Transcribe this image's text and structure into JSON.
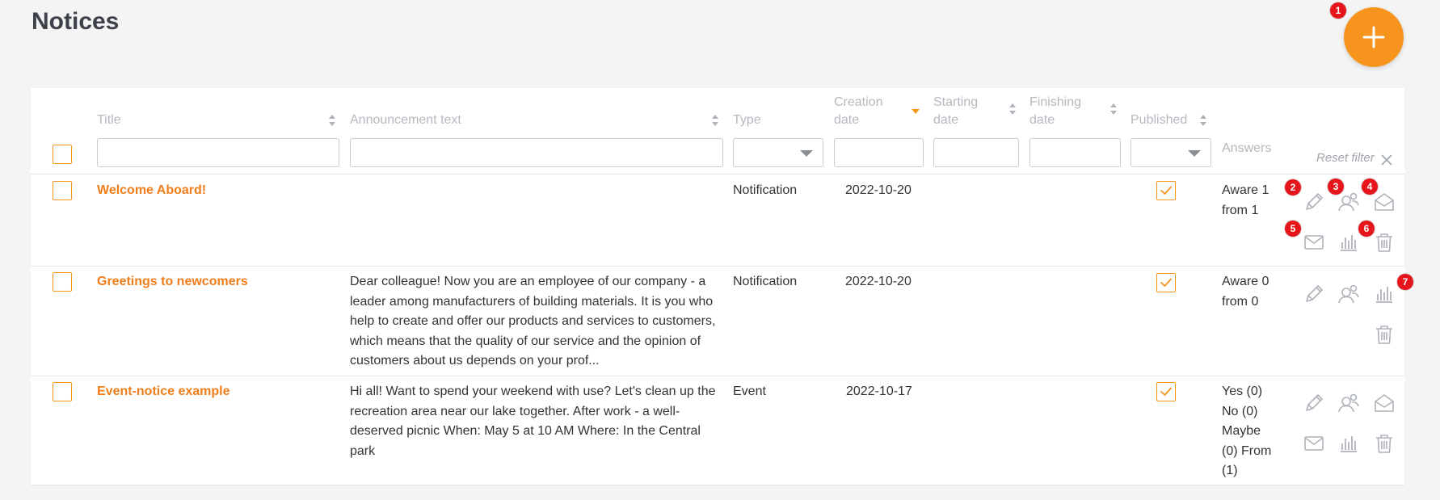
{
  "page": {
    "title": "Notices"
  },
  "toolbar": {
    "add_label": "+"
  },
  "table": {
    "headers": {
      "title": "Title",
      "announcement": "Announcement text",
      "type": "Type",
      "creation_date": "Creation date",
      "starting_date": "Starting date",
      "finishing_date": "Finishing date",
      "published": "Published",
      "answers": "Answers"
    },
    "reset_filter": "Reset filter",
    "rows": [
      {
        "title": "Welcome Aboard!",
        "announcement": "",
        "type": "Notification",
        "creation_date": "2022-10-20",
        "starting_date": "",
        "finishing_date": "",
        "published": true,
        "answers": "Aware 1 from 1"
      },
      {
        "title": "Greetings to newcomers",
        "announcement": "Dear colleague! Now you are an employee of our company - a leader among manufacturers of building materials. It is you who help to create and offer our products and services to customers, which means that the quality of our service and the opinion of customers about us depends on your prof...",
        "type": "Notification",
        "creation_date": "2022-10-20",
        "starting_date": "",
        "finishing_date": "",
        "published": true,
        "answers": "Aware 0 from 0"
      },
      {
        "title": "Event-notice example",
        "announcement": "Hi all!  Want to spend your weekend with use? Let's clean up the recreation area near our lake together. After work - a well-deserved picnic  When: May 5 at 10 AM  Where: In the Central park",
        "type": "Event",
        "creation_date": "2022-10-17",
        "starting_date": "",
        "finishing_date": "",
        "published": true,
        "answers": "Yes (0) No (0) Maybe (0) From (1)"
      }
    ]
  },
  "markers": [
    "1",
    "2",
    "3",
    "4",
    "5",
    "6",
    "7"
  ],
  "icons": {
    "add": "plus-icon",
    "edit": "pencil-icon",
    "recipients": "users-icon",
    "open_mail": "envelope-open-icon",
    "mail": "envelope-icon",
    "stats": "bar-chart-icon",
    "delete": "trash-icon"
  },
  "colors": {
    "accent": "#f7941d",
    "link": "#f07d1a",
    "marker": "#e8141c",
    "icon": "#aeb3ba"
  }
}
